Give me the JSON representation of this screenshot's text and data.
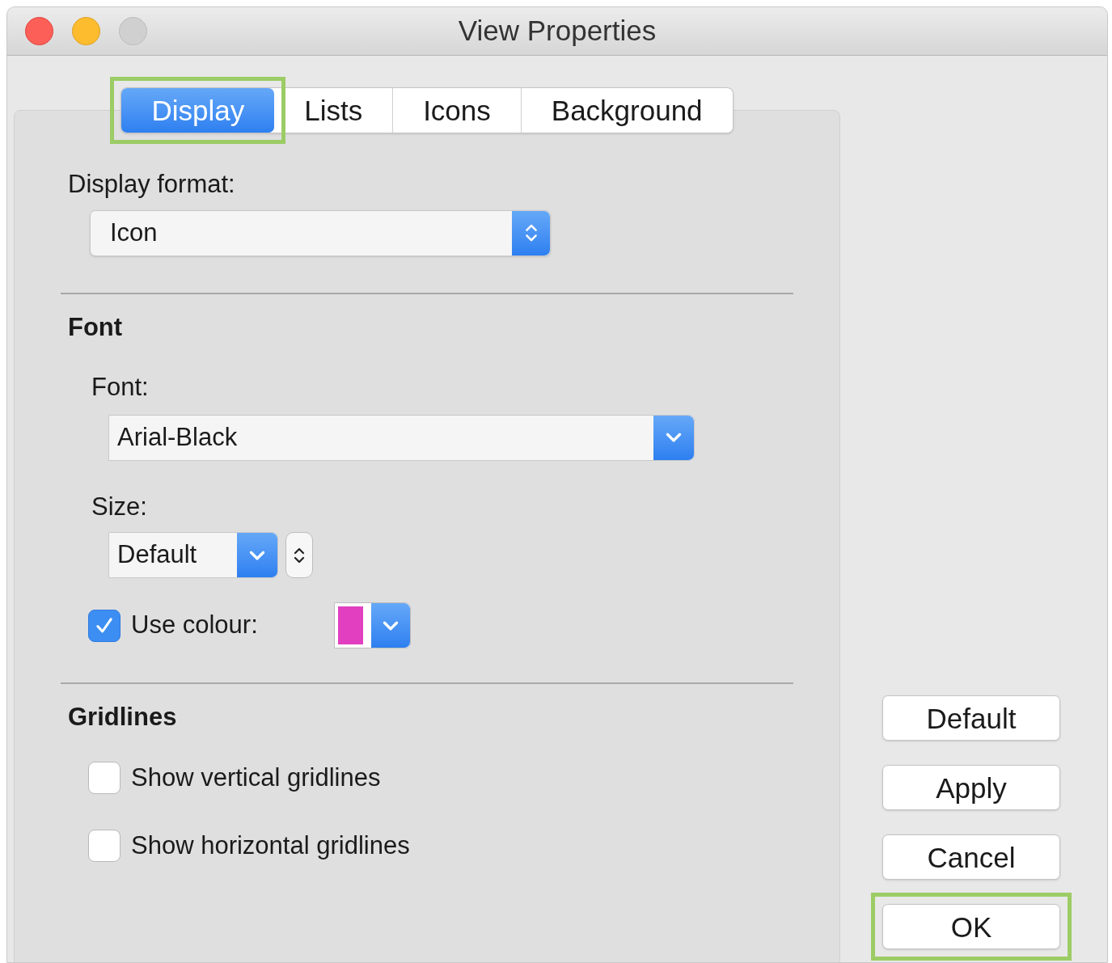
{
  "window": {
    "title": "View Properties"
  },
  "tabs": [
    {
      "label": "Display",
      "selected": true,
      "highlighted": true
    },
    {
      "label": "Lists",
      "selected": false,
      "highlighted": false
    },
    {
      "label": "Icons",
      "selected": false,
      "highlighted": false
    },
    {
      "label": "Background",
      "selected": false,
      "highlighted": false
    }
  ],
  "display_format": {
    "label": "Display format:",
    "value": "Icon"
  },
  "font_section": {
    "heading": "Font",
    "font_label": "Font:",
    "font_value": "Arial-Black",
    "size_label": "Size:",
    "size_value": "Default",
    "use_colour": {
      "label": "Use colour:",
      "checked": true,
      "color": "#e23fc0"
    }
  },
  "gridlines": {
    "heading": "Gridlines",
    "options": [
      {
        "label": "Show vertical gridlines",
        "checked": false
      },
      {
        "label": "Show horizontal gridlines",
        "checked": false
      }
    ]
  },
  "buttons": [
    {
      "label": "Default",
      "highlighted": false
    },
    {
      "label": "Apply",
      "highlighted": false
    },
    {
      "label": "Cancel",
      "highlighted": false
    },
    {
      "label": "OK",
      "highlighted": true
    }
  ]
}
